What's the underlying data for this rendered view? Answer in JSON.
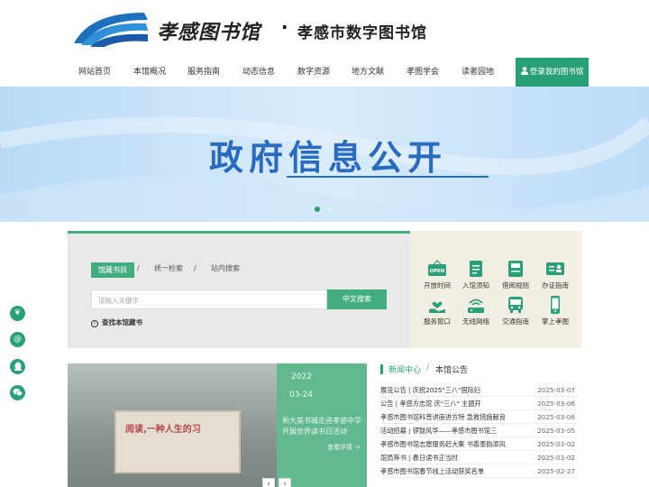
{
  "header": {
    "logo_calligraphy": "孝感图书馆",
    "logo_dot": "·",
    "site_name": "孝感市数字图书馆",
    "brand_color": "#2aa079"
  },
  "nav": {
    "items": [
      {
        "label": "网站首页"
      },
      {
        "label": "本馆概况"
      },
      {
        "label": "服务指南"
      },
      {
        "label": "动态信息"
      },
      {
        "label": "数字资源"
      },
      {
        "label": "地方文献"
      },
      {
        "label": "孝图学会"
      },
      {
        "label": "读者园地"
      }
    ],
    "login_label": "登录我的图书馆",
    "login_icon": "user-icon"
  },
  "banner": {
    "title": "政府信息公开",
    "slides": 2,
    "active_slide": 1
  },
  "search": {
    "tabs": [
      {
        "label": "馆藏书目",
        "active": true
      },
      {
        "label": "统一检索",
        "active": false
      },
      {
        "label": "站内搜索",
        "active": false
      }
    ],
    "separator": "/",
    "placeholder": "请输入关键字",
    "button_label": "中文搜索",
    "hint_icon": "info-icon",
    "hint": "查找本馆藏书"
  },
  "services": [
    {
      "label": "开放时间",
      "icon": "open-sign-icon"
    },
    {
      "label": "入馆须知",
      "icon": "notice-document-icon"
    },
    {
      "label": "借阅规则",
      "icon": "book-rules-icon"
    },
    {
      "label": "办证指南",
      "icon": "id-card-icon"
    },
    {
      "label": "服务窗口",
      "icon": "hand-heart-icon"
    },
    {
      "label": "无线网络",
      "icon": "wifi-router-icon"
    },
    {
      "label": "交通指南",
      "icon": "bus-icon"
    },
    {
      "label": "掌上孝图",
      "icon": "mobile-phone-icon"
    }
  ],
  "side_icons": [
    "leaf-icon",
    "at-icon",
    "qq-penguin-icon",
    "wechat-icon"
  ],
  "slideshow": {
    "year": "2022",
    "date": "03-24",
    "screen_text": "阅读,一种人生的习",
    "caption": "新大美书城走进孝感中学开展世界读书日活动",
    "more": "查看详情 →",
    "prev": "‹",
    "next": "›"
  },
  "news": {
    "section_title": "新闻中心",
    "separator": "/",
    "tab_title": "本馆公告",
    "items": [
      {
        "title": "展览公告 | 庆祝2025\"三八\"国际妇",
        "date": "2025-03-07"
      },
      {
        "title": "公告 | 孝感方志馆 庆\"三八\" 主题开",
        "date": "2025-03-06"
      },
      {
        "title": "孝感市图书馆科普讲座进方特 急救措施献良",
        "date": "2025-03-06"
      },
      {
        "title": "活动招募 | 锣鼓风华——孝感市图书馆三",
        "date": "2025-03-05"
      },
      {
        "title": "孝感市图书馆志愿服务赶大集 书香墨韵添风",
        "date": "2025-03-02"
      },
      {
        "title": "馆员荐书 | 春日读书正当时",
        "date": "2025-03-02"
      },
      {
        "title": "孝感市图书馆春节线上活动获奖名单",
        "date": "2025-02-27"
      }
    ]
  }
}
